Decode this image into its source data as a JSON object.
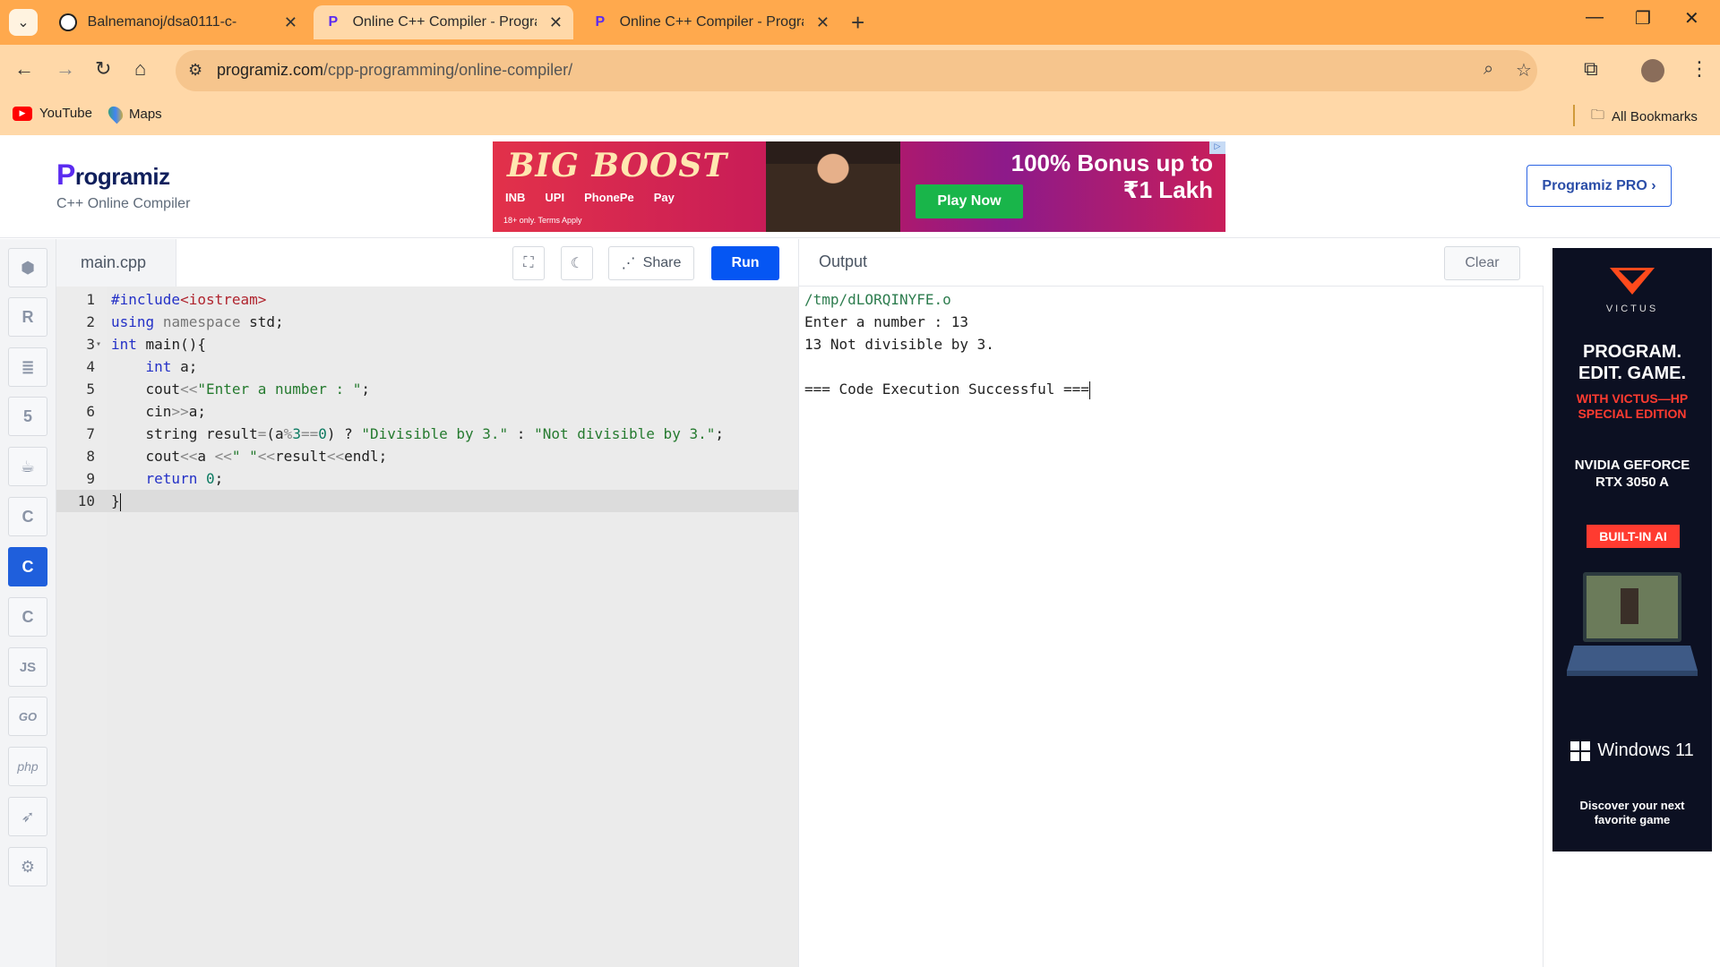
{
  "browser": {
    "tabs": [
      {
        "title": "Balnemanoj/dsa0111-c-",
        "icon": "github-icon",
        "active": false
      },
      {
        "title": "Online C++ Compiler - Program",
        "icon": "programiz-icon",
        "active": true
      },
      {
        "title": "Online C++ Compiler - Program",
        "icon": "programiz-icon",
        "active": false
      }
    ],
    "url_domain": "programiz.com",
    "url_path": "/cpp-programming/online-compiler/",
    "bookmarks": [
      {
        "label": "YouTube",
        "icon": "youtube-icon"
      },
      {
        "label": "Maps",
        "icon": "maps-icon"
      }
    ],
    "all_bookmarks": "All Bookmarks"
  },
  "header": {
    "logo": "rogramiz",
    "logo_initial": "P",
    "subtitle": "C++ Online Compiler",
    "pro_button": "Programiz PRO ›"
  },
  "ad_top": {
    "headline": "BIG BOOST",
    "payments": [
      "INB",
      "UPI",
      "PhonePe",
      "Pay"
    ],
    "terms": "18+ only. Terms Apply",
    "bonus_line1": "100% Bonus up to",
    "bonus_line2": "₹1 Lakh",
    "cta": "Play Now"
  },
  "rail": {
    "items": [
      "python",
      "r",
      "sql",
      "html",
      "java",
      "c",
      "cpp",
      "csharp",
      "js",
      "go",
      "php",
      "swift",
      "rust"
    ],
    "labels": {
      "js": "JS",
      "go": "GO",
      "php": "php"
    },
    "active": "cpp"
  },
  "editor": {
    "file_name": "main.cpp",
    "share_label": "Share",
    "run_label": "Run",
    "line_numbers": [
      "1",
      "2",
      "3",
      "4",
      "5",
      "6",
      "7",
      "8",
      "9",
      "10"
    ],
    "current_line": 10
  },
  "output": {
    "title": "Output",
    "clear_label": "Clear",
    "lines": [
      "/tmp/dLORQINYFE.o",
      "Enter a number : 13",
      "13 Not divisible by 3.",
      "",
      "=== Code Execution Successful ==="
    ]
  },
  "ad_side": {
    "brand": "VICTUS",
    "tagline1": "PROGRAM.",
    "tagline2": "EDIT. GAME.",
    "hp1": "WITH VICTUS—HP",
    "hp2": "SPECIAL EDITION",
    "nv1": "NVIDIA GEFORCE",
    "nv2": "RTX 3050 A",
    "ai": "BUILT-IN AI",
    "windows": "Windows 11",
    "discover1": "Discover your next",
    "discover2": "favorite game"
  }
}
